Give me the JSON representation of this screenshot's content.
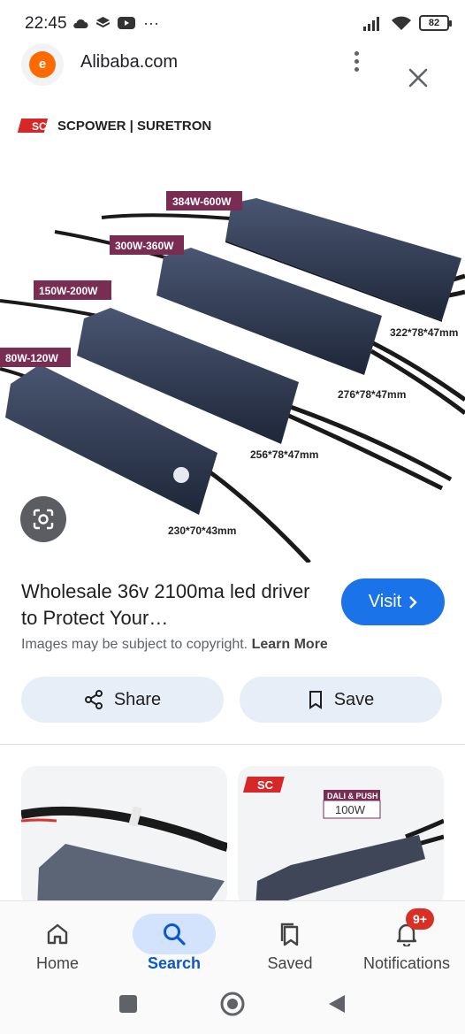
{
  "status_bar": {
    "time": "22:45",
    "battery": "82",
    "more_indicator": "···"
  },
  "header": {
    "site_title": "Alibaba.com",
    "site_icon_letter": "e"
  },
  "hero": {
    "brand": "SCPOWER | SURETRON",
    "brand_logo_text": "SC",
    "products": [
      {
        "label": "384W-600W",
        "dims": "322*78*47mm"
      },
      {
        "label": "300W-360W",
        "dims": "276*78*47mm"
      },
      {
        "label": "150W-200W",
        "dims": "256*78*47mm"
      },
      {
        "label": "80W-120W",
        "dims": "230*70*43mm"
      }
    ]
  },
  "result": {
    "title": "Wholesale 36v 2100ma led driver to Protect Your…",
    "visit_label": "Visit",
    "copyright_text": "Images may be subject to copyright.",
    "learn_more": "Learn More",
    "share_label": "Share",
    "save_label": "Save"
  },
  "thumbs": {
    "second_logo": "SC",
    "second_badge_top": "DALI & PUSH",
    "second_badge_main": "100W"
  },
  "bottom_nav": {
    "items": [
      {
        "label": "Home",
        "icon": "home-icon"
      },
      {
        "label": "Search",
        "icon": "search-icon"
      },
      {
        "label": "Saved",
        "icon": "bookmarks-icon"
      },
      {
        "label": "Notifications",
        "icon": "bell-icon"
      }
    ],
    "notif_badge": "9+"
  },
  "colors": {
    "accent": "#1a73e8",
    "pill_bg": "#e8eef8",
    "badge": "#d93025",
    "driver_body": "#2e3a52"
  }
}
